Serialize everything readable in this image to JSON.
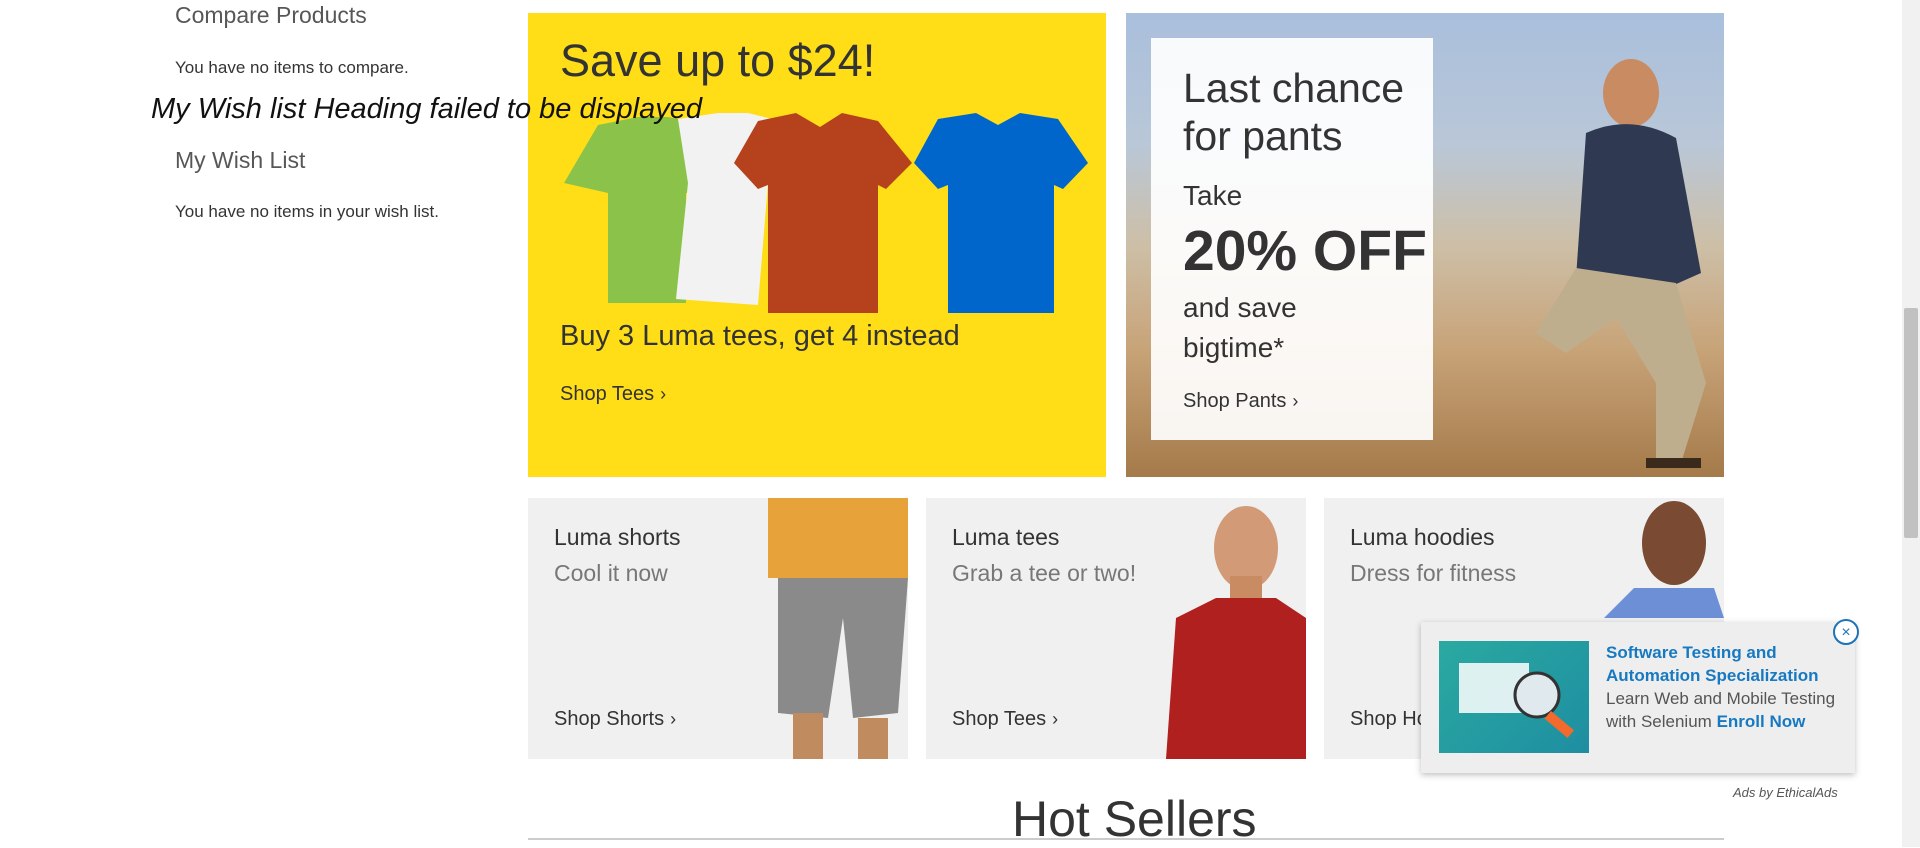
{
  "sidebar": {
    "compare_title": "Compare Products",
    "compare_text": "You have no items to compare.",
    "wish_title": "My Wish List",
    "wish_text": "You have no items in your wish list."
  },
  "overlay_error": "My Wish list Heading failed to be displayed",
  "promo_tees": {
    "headline": "Save up to $24!",
    "sub": "Buy 3 Luma tees, get 4 instead",
    "shop_label": "Shop Tees",
    "shirt_colors": [
      "#8bc34a",
      "#f2f2f2",
      "#b5421c",
      "#0066cc"
    ]
  },
  "promo_pants": {
    "heading_line1": "Last chance",
    "heading_line2": "for pants",
    "take": "Take",
    "discount": "20% OFF",
    "save_line1": "and save",
    "save_line2": "bigtime*",
    "shop_label": "Shop Pants"
  },
  "tiles": [
    {
      "title": "Luma shorts",
      "subtitle": "Cool it now",
      "shop_label": "Shop Shorts"
    },
    {
      "title": "Luma tees",
      "subtitle": "Grab a tee or two!",
      "shop_label": "Shop Tees"
    },
    {
      "title": "Luma hoodies",
      "subtitle": "Dress for fitness",
      "shop_label": "Shop Ho"
    }
  ],
  "hot_sellers": "Hot Sellers",
  "ad": {
    "title": "Software Testing and Automation Specialization",
    "body": "Learn Web and Mobile Testing with Selenium",
    "cta": "Enroll Now",
    "close": "×",
    "by": "Ads by EthicalAds"
  },
  "chevron": "›"
}
